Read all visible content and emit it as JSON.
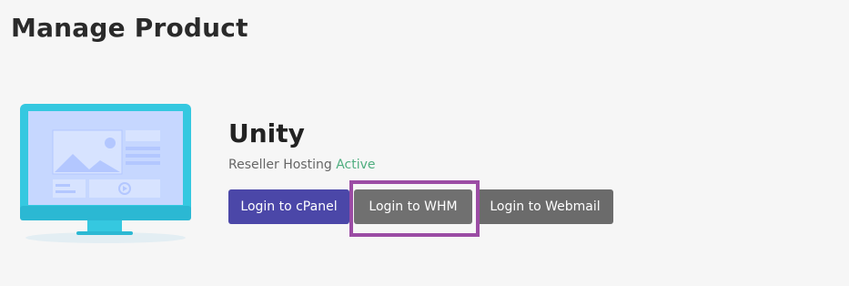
{
  "page": {
    "title": "Manage Product"
  },
  "product": {
    "name": "Unity",
    "type": "Reseller Hosting",
    "status": "Active",
    "illustration_icon": "monitor-illustration-icon"
  },
  "actions": {
    "cpanel_label": "Login to cPanel",
    "whm_label": "Login to WHM",
    "webmail_label": "Login to Webmail"
  },
  "colors": {
    "cpanel_button": "#4b47a8",
    "whm_button": "#707070",
    "webmail_button": "#6b6b6b",
    "status_active": "#4fae7f",
    "highlight_box": "#9b4ca4"
  }
}
